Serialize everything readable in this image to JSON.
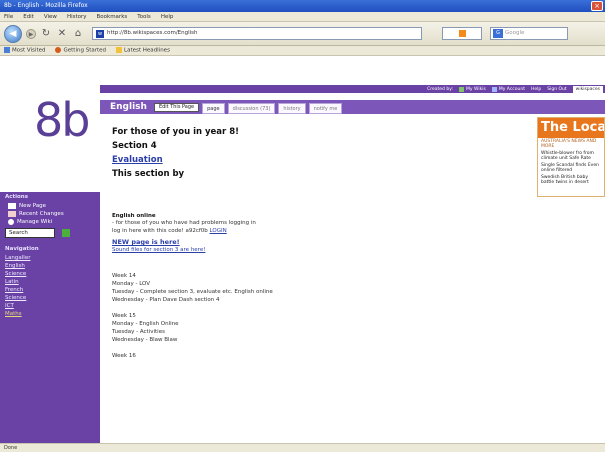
{
  "window": {
    "title": "8b - English - Mozilla Firefox"
  },
  "menubar": [
    "File",
    "Edit",
    "View",
    "History",
    "Bookmarks",
    "Tools",
    "Help"
  ],
  "navbar": {
    "url": "http://8b.wikispaces.com/English",
    "search_placeholder": "Google"
  },
  "bookmarks": [
    {
      "label": "Most Visited",
      "icon": "star-icon"
    },
    {
      "label": "Getting Started",
      "icon": "firefox-icon"
    },
    {
      "label": "Latest Headlines",
      "icon": "rss-icon"
    }
  ],
  "wiki": {
    "logo": "8b",
    "top_links": {
      "created_by": "Created by:",
      "my_wikis": "My Wikis",
      "my_account": "My Account",
      "help": "Help",
      "sign_out": "Sign Out",
      "wikispaces": "wikispaces"
    },
    "page_title": "English",
    "edit_button": "Edit This Page",
    "tabs": [
      "page",
      "discussion (73)",
      "history",
      "notify me"
    ]
  },
  "sidebar": {
    "actions_heading": "Actions",
    "actions": [
      "New Page",
      "Recent Changes",
      "Manage Wiki"
    ],
    "search_value": "Search",
    "nav_heading": "Navigation",
    "nav": [
      "Langaller",
      "English",
      "Science",
      "Latin",
      "French",
      "Science",
      "ICT",
      "Maths"
    ]
  },
  "content": {
    "heading": "For those of you in year 8!",
    "section": "Section 4",
    "evaluation": "Evaluation",
    "section_by": "This section by",
    "english_online": "English online",
    "online_line1": "- for those of you who have had problems logging in",
    "online_line2": "log in here with this code! a92cf0b",
    "online_link": "LOGIN",
    "new_page": "NEW page is here!",
    "sound_files": "Sound files for section 3 are here!",
    "week14": "Week 14",
    "w14_lines": [
      "Monday - LOV",
      "Tuesday - Complete section 3, evaluate etc. English online",
      "Wednesday - Plan Dave Dash section 4"
    ],
    "week15": "Week 15",
    "w15_lines": [
      "Monday - English Online",
      "Tuesday - Activities",
      "Wednesday - Blaw Blaw"
    ],
    "week16": "Week 16"
  },
  "ad": {
    "banner": "The Loca",
    "tag": "AUSTRALIA'S NEWS AND MORE",
    "items": [
      "Whistle-blower fro from climate unit Safe Rate",
      "Single Scandal finds Even online filtered",
      "Swedish British baby battle twins in desert"
    ]
  },
  "statusbar": "Done"
}
